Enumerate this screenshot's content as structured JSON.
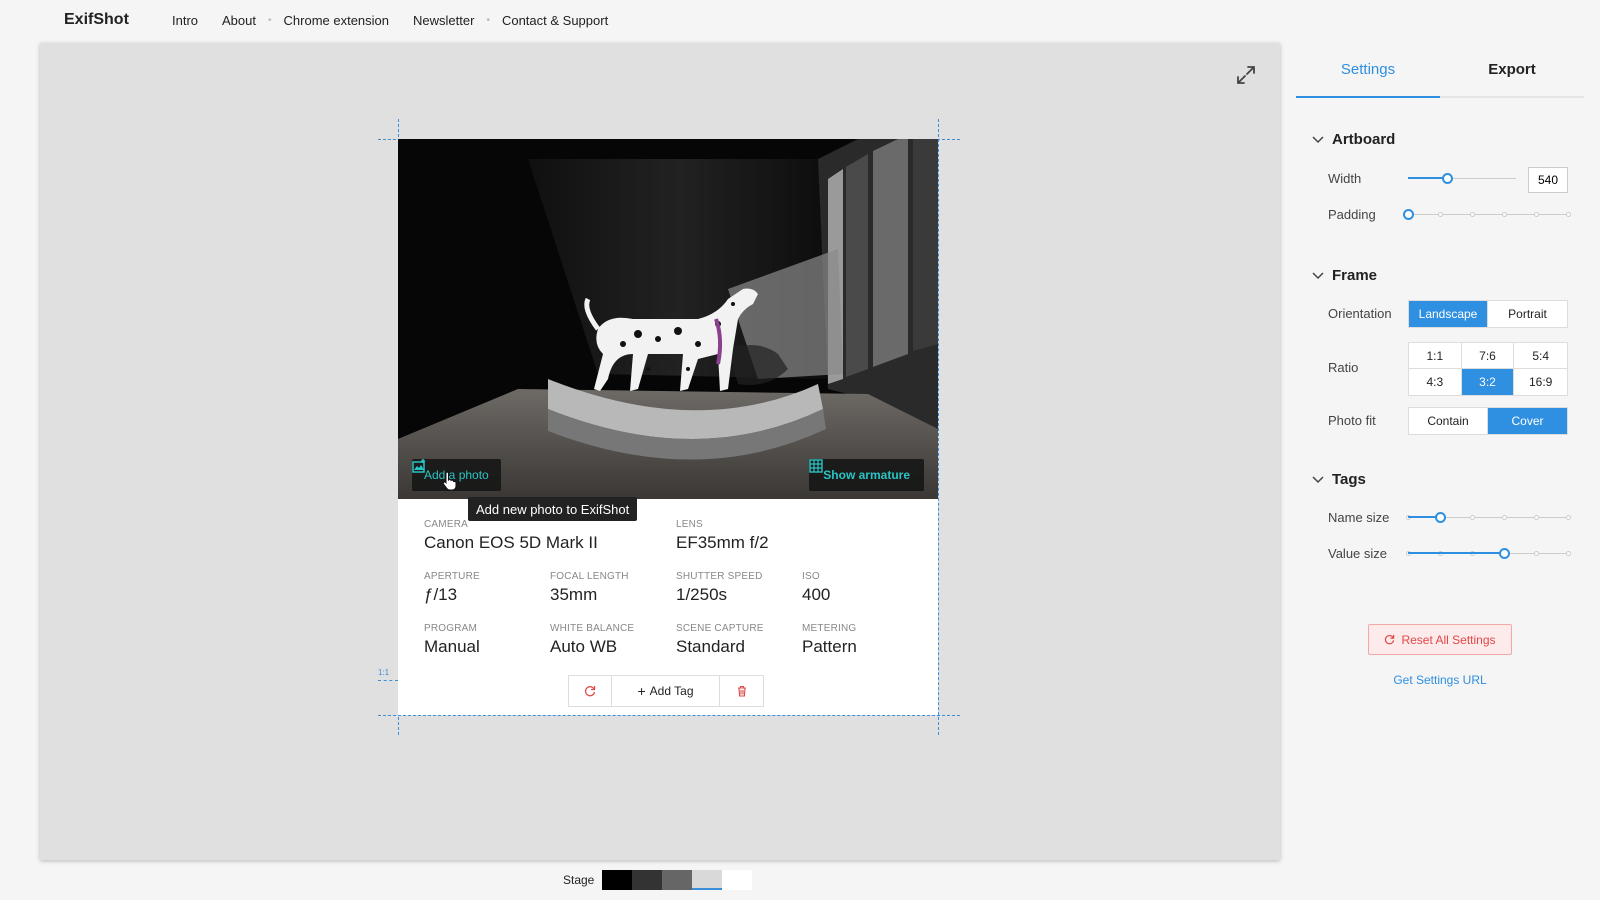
{
  "brand": "ExifShot",
  "nav": [
    "Intro",
    "About",
    "Chrome extension",
    "Newsletter",
    "Contact & Support"
  ],
  "photo": {
    "add_photo_label": "Add a photo",
    "show_armature_label": "Show armature",
    "tooltip": "Add new photo to ExifShot"
  },
  "exif": {
    "camera": {
      "label": "Camera",
      "value": "Canon EOS 5D Mark II"
    },
    "lens": {
      "label": "Lens",
      "value": "EF35mm f/2"
    },
    "aperture": {
      "label": "Aperture",
      "value": "ƒ/13"
    },
    "focal_length": {
      "label": "Focal Length",
      "value": "35mm"
    },
    "shutter_speed": {
      "label": "Shutter Speed",
      "value": "1/250s"
    },
    "iso": {
      "label": "ISO",
      "value": "400"
    },
    "program": {
      "label": "Program",
      "value": "Manual"
    },
    "white_balance": {
      "label": "White Balance",
      "value": "Auto WB"
    },
    "scene_capture": {
      "label": "Scene Capture",
      "value": "Standard"
    },
    "metering": {
      "label": "Metering",
      "value": "Pattern"
    }
  },
  "tag_bar": {
    "add_tag_label": "Add Tag"
  },
  "ratio_marker": "1:1",
  "stage_bg": {
    "label": "Stage",
    "swatches": [
      "#000000",
      "#333333",
      "#666666",
      "#d9d9d9",
      "#ffffff"
    ],
    "selected_index": 3
  },
  "panel": {
    "tabs": {
      "settings": "Settings",
      "export": "Export"
    },
    "artboard": {
      "title": "Artboard",
      "width_label": "Width",
      "width_value": "540",
      "width_slider_fraction": 0.36,
      "padding_label": "Padding",
      "padding_slider_fraction": 0.0
    },
    "frame": {
      "title": "Frame",
      "orientation_label": "Orientation",
      "orientation_options": [
        "Landscape",
        "Portrait"
      ],
      "orientation_selected": "Landscape",
      "ratio_label": "Ratio",
      "ratio_options": [
        "1:1",
        "7:6",
        "5:4",
        "4:3",
        "3:2",
        "16:9"
      ],
      "ratio_selected": "3:2",
      "photo_fit_label": "Photo fit",
      "photo_fit_options": [
        "Contain",
        "Cover"
      ],
      "photo_fit_selected": "Cover"
    },
    "tags": {
      "title": "Tags",
      "name_size_label": "Name size",
      "name_size_fraction": 0.2,
      "value_size_label": "Value size",
      "value_size_fraction": 0.6
    },
    "reset_label": "Reset All Settings",
    "settings_url_label": "Get Settings URL"
  },
  "colors": {
    "accent": "#2f8fe0",
    "teal": "#29c5c5",
    "danger": "#e04848"
  }
}
